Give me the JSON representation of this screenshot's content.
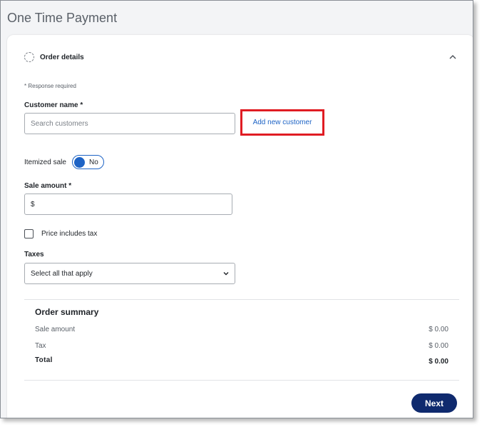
{
  "page": {
    "title": "One Time Payment"
  },
  "section": {
    "title": "Order details",
    "collapse_icon": "chevron-up-icon",
    "status_icon": "dashed-circle-icon"
  },
  "form": {
    "required_note": "* Response required",
    "customer": {
      "label": "Customer name *",
      "placeholder": "Search customers",
      "add_link": "Add new customer"
    },
    "itemized": {
      "label": "Itemized sale",
      "toggle_text": "No"
    },
    "sale_amount": {
      "label": "Sale amount *",
      "prefix": "$",
      "value": ""
    },
    "price_includes_tax": {
      "label": "Price includes tax",
      "checked": false
    },
    "taxes": {
      "label": "Taxes",
      "selected": "Select all that apply"
    }
  },
  "summary": {
    "title": "Order summary",
    "rows": [
      {
        "label": "Sale amount",
        "value": "$ 0.00"
      },
      {
        "label": "Tax",
        "value": "$ 0.00"
      }
    ],
    "total": {
      "label": "Total",
      "value": "$ 0.00"
    }
  },
  "actions": {
    "next_label": "Next"
  },
  "colors": {
    "accent": "#1d63c5",
    "primary_button": "#0f2a6e",
    "highlight_border": "#e01c23"
  }
}
